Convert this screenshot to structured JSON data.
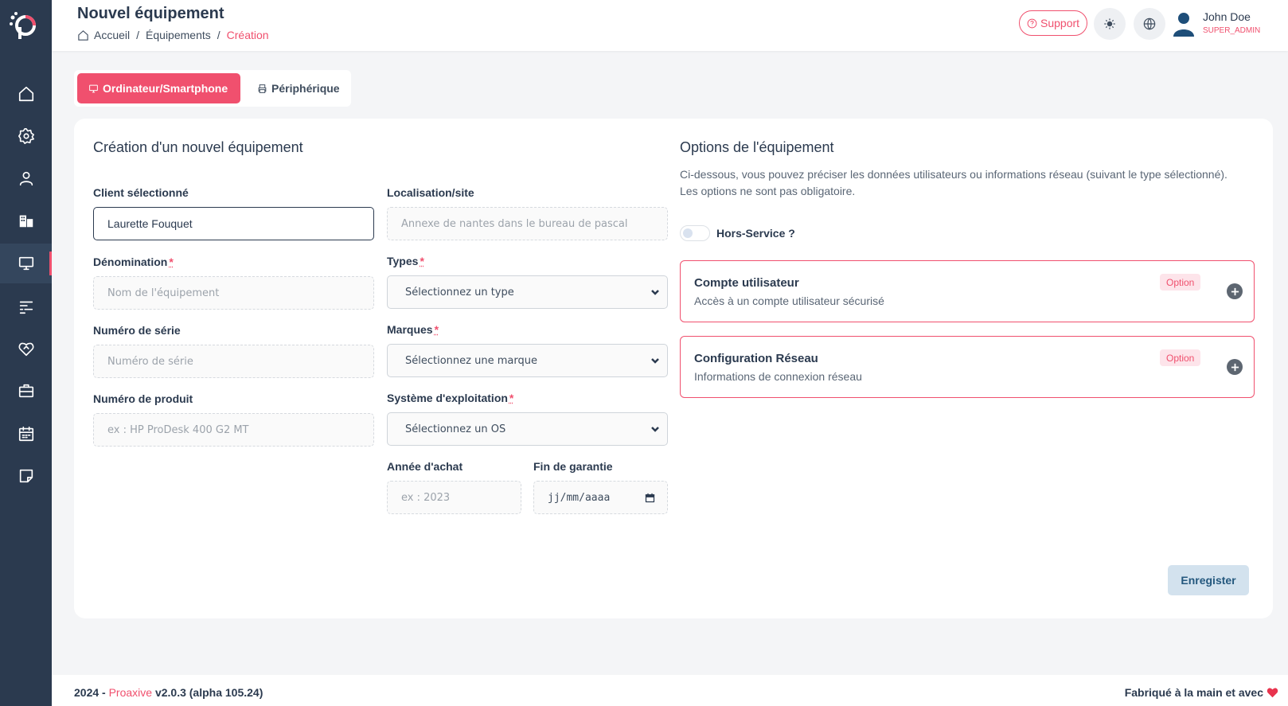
{
  "colors": {
    "accent": "#f0506e",
    "sidebar_bg": "#2b3a4f",
    "save_button_bg": "#d3e2ee"
  },
  "header": {
    "page_title": "Nouvel équipement",
    "breadcrumb": [
      "Accueil",
      "Équipements",
      "Création"
    ],
    "support_label": "Support",
    "user_name": "John Doe",
    "user_role": "SUPER_ADMIN"
  },
  "sidebar": {
    "items": [
      {
        "icon": "home-icon"
      },
      {
        "icon": "settings-icon"
      },
      {
        "icon": "user-icon"
      },
      {
        "icon": "building-icon"
      },
      {
        "icon": "monitor-icon",
        "active": true
      },
      {
        "icon": "list-icon"
      },
      {
        "icon": "heart-handshake-icon"
      },
      {
        "icon": "briefcase-icon"
      },
      {
        "icon": "calendar-icon"
      },
      {
        "icon": "note-icon"
      }
    ]
  },
  "tabs": {
    "computer_label": "Ordinateur/Smartphone",
    "peripheral_label": "Périphérique"
  },
  "form": {
    "title": "Création d'un nouvel équipement",
    "client_label": "Client sélectionné",
    "client_value": "Laurette Fouquet",
    "location_label": "Localisation/site",
    "location_placeholder": "Annexe de nantes dans le bureau de pascal",
    "name_label": "Dénomination",
    "name_placeholder": "Nom de l'équipement",
    "types_label": "Types",
    "types_value": "Sélectionnez un type",
    "serial_label": "Numéro de série",
    "serial_placeholder": "Numéro de série",
    "brands_label": "Marques",
    "brands_value": "Sélectionnez une marque",
    "product_label": "Numéro de produit",
    "product_placeholder": "ex : HP ProDesk 400 G2 MT",
    "os_label": "Système d'exploitation",
    "os_value": "Sélectionnez un OS",
    "year_label": "Année d'achat",
    "year_placeholder": "ex : 2023",
    "warranty_label": "Fin de garantie",
    "warranty_placeholder": "jj/mm/aaaa",
    "required_mark": "*",
    "save_label": "Enregister"
  },
  "options": {
    "title": "Options de l'équipement",
    "description": "Ci-dessous, vous pouvez préciser les données utilisateurs ou informations réseau (suivant le type sélectionné). Les options ne sont pas obligatoire.",
    "out_of_service_label": "Hors-Service ?",
    "out_of_service_on": false,
    "user_account_title": "Compte utilisateur",
    "user_account_sub": "Accès à un compte utilisateur sécurisé",
    "network_title": "Configuration Réseau",
    "network_sub": "Informations de connexion réseau",
    "badge_label": "Option"
  },
  "footer": {
    "year_prefix": "2024 -",
    "brand": "Proaxive",
    "version": "v2.0.3 (alpha 105.24)",
    "made_with": "Fabriqué à la main et avec"
  }
}
